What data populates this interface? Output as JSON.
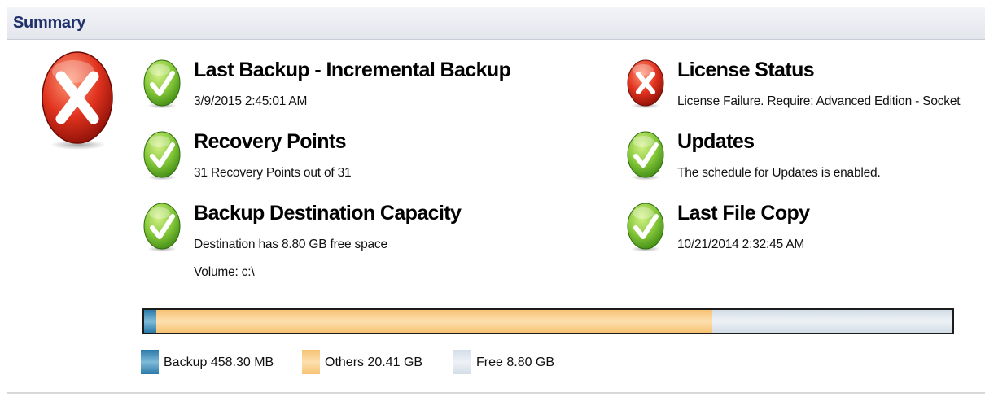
{
  "header": {
    "title": "Summary"
  },
  "overall_status": {
    "icon": "error-icon",
    "state": "error"
  },
  "status_items": {
    "last_backup": {
      "icon": "success-check-icon",
      "title": "Last Backup - Incremental Backup",
      "detail": "3/9/2015 2:45:01 AM"
    },
    "recovery_points": {
      "icon": "success-check-icon",
      "title": "Recovery Points",
      "detail": "31 Recovery Points out of 31"
    },
    "destination_capacity": {
      "icon": "success-check-icon",
      "title": "Backup Destination Capacity",
      "detail": "Destination has 8.80 GB free space",
      "volume": "Volume: c:\\"
    },
    "license_status": {
      "icon": "error-icon",
      "title": "License Status",
      "detail": "License Failure. Require: Advanced Edition - Socket"
    },
    "updates": {
      "icon": "success-check-icon",
      "title": "Updates",
      "detail": "The schedule for Updates is enabled."
    },
    "last_file_copy": {
      "icon": "success-check-icon",
      "title": "Last File Copy",
      "detail": "10/21/2014 2:32:45 AM"
    }
  },
  "capacity": {
    "backup_gb": 0.4583,
    "others_gb": 20.41,
    "free_gb": 8.8,
    "legend": {
      "backup": "Backup 458.30 MB",
      "others": "Others 20.41 GB",
      "free": "Free 8.80 GB"
    },
    "colors": {
      "backup": "#2a79a8",
      "others": "#f6c272",
      "free": "#d3dde7"
    }
  },
  "colors": {
    "header_text": "#20306a",
    "success": "#6fb62a",
    "error": "#d22a1e"
  }
}
